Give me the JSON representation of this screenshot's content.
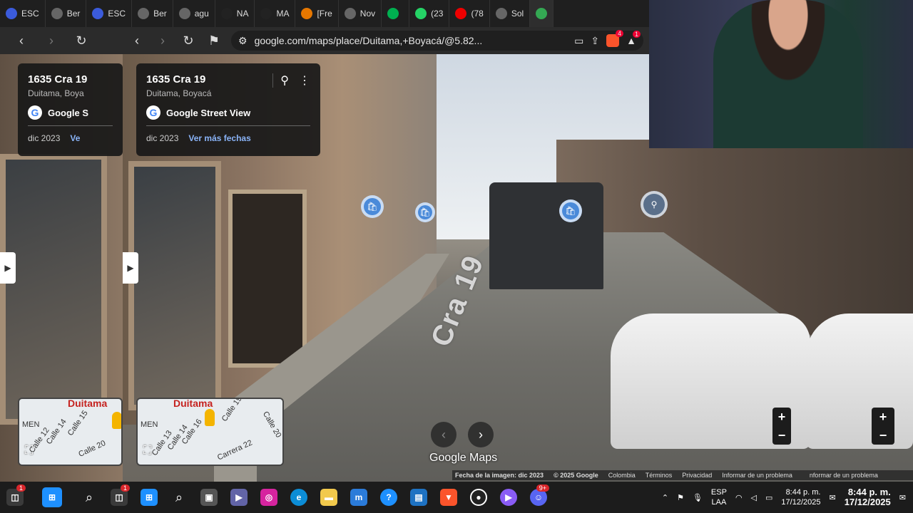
{
  "browser": {
    "tabs": [
      {
        "label": "ESC",
        "color": "#3b5bdb"
      },
      {
        "label": "Ber",
        "color": "#666"
      },
      {
        "label": "ESC",
        "color": "#3b5bdb"
      },
      {
        "label": "Ber",
        "color": "#666"
      },
      {
        "label": "agu",
        "color": "#666"
      },
      {
        "label": "NA",
        "color": "#222"
      },
      {
        "label": "MA",
        "color": "#222"
      },
      {
        "label": "[Fre",
        "color": "#e67700"
      },
      {
        "label": "Nov",
        "color": "#666"
      },
      {
        "label": "",
        "color": "#00b050"
      },
      {
        "label": "(23",
        "color": "#25d366"
      },
      {
        "label": "(78",
        "color": "#e00"
      },
      {
        "label": "Sol",
        "color": "#666"
      }
    ],
    "url": "google.com/maps/place/Duitama,+Boyacá/@5.82...",
    "brave_badge": "4",
    "alert_badge": "1"
  },
  "place_card": {
    "title": "1635 Cra 19",
    "subtitle": "Duitama, Boyacá",
    "source": "Google Street View",
    "date": "dic 2023",
    "more_dates": "Ver más fechas"
  },
  "ghost_card": {
    "title": "1635 Cra 19",
    "subtitle": "Duitama, Boya",
    "source": "Google S",
    "date": "dic 2023",
    "more_dates": "Ve"
  },
  "scene": {
    "road_label": "Cra 19",
    "brand": "Google Maps"
  },
  "minimap": {
    "city": "Duitama",
    "labels": [
      "MEN",
      "Calle 16",
      "Calle 15",
      "Calle 14",
      "Calle 13",
      "Calle 12",
      "Calle 19",
      "Calle 20",
      "Carrera 22"
    ]
  },
  "footer": [
    "Fecha de la imagen: dic 2023",
    "© 2025 Google",
    "Colombia",
    "Términos",
    "Privacidad",
    "Informar de un problema"
  ],
  "footer_right": "nformar de un problema",
  "taskbar": {
    "badges": {
      "notif": "1",
      "discord": "9+"
    },
    "lang_top": "ESP",
    "lang_bottom": "LAA",
    "time": "8:44 p. m.",
    "date": "17/12/2025"
  }
}
